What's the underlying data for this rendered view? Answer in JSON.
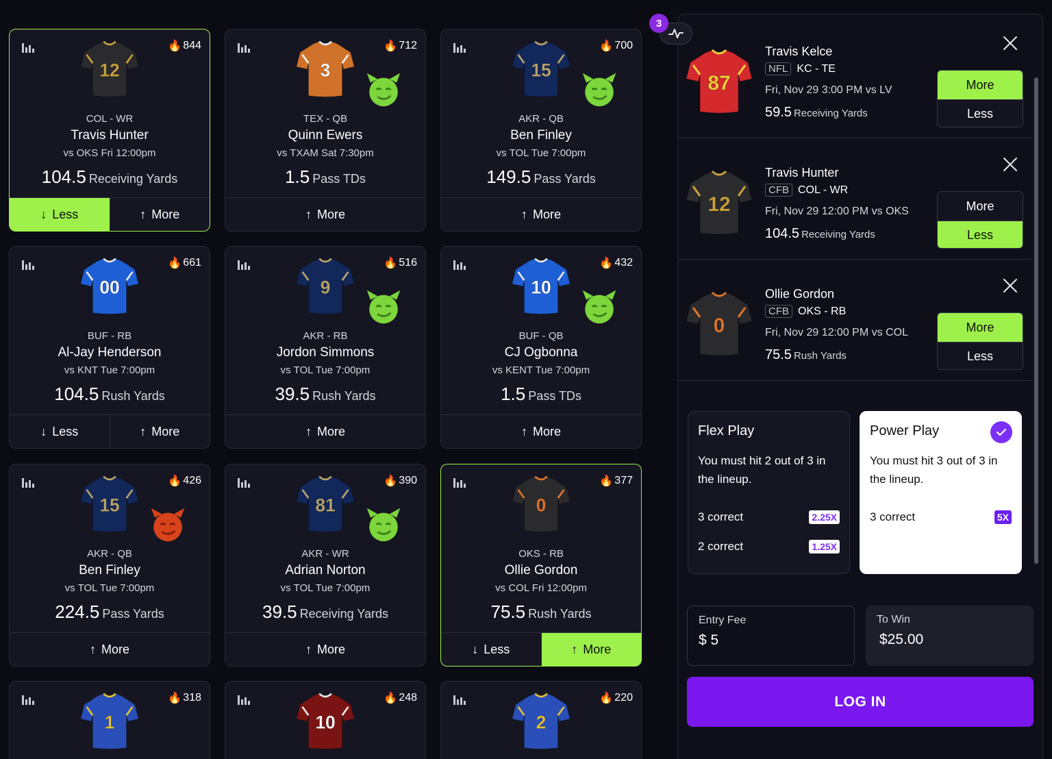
{
  "cards": [
    {
      "pos": "COL - WR",
      "name": "Travis Hunter",
      "game": "vs OKS Fri 12:00pm",
      "line": "104.5",
      "stat": "Receiving Yards",
      "heat": "844",
      "jersey": {
        "color": "#2b2b2e",
        "trim": "#c9a13f",
        "number": "12"
      },
      "emoji": "none",
      "actions": [
        {
          "label": "Less",
          "dir": "down",
          "on": true
        },
        {
          "label": "More",
          "dir": "up",
          "on": false
        }
      ],
      "selected": true
    },
    {
      "pos": "TEX - QB",
      "name": "Quinn Ewers",
      "game": "vs TXAM Sat 7:30pm",
      "line": "1.5",
      "stat": "Pass TDs",
      "heat": "712",
      "jersey": {
        "color": "#d0722a",
        "trim": "#f2f2f2",
        "number": "3"
      },
      "emoji": "goblin",
      "actions": [
        {
          "label": "More",
          "dir": "up",
          "on": false
        }
      ],
      "selected": false
    },
    {
      "pos": "AKR - QB",
      "name": "Ben Finley",
      "game": "vs TOL Tue 7:00pm",
      "line": "149.5",
      "stat": "Pass Yards",
      "heat": "700",
      "jersey": {
        "color": "#12275a",
        "trim": "#b8a46a",
        "number": "15"
      },
      "emoji": "goblin",
      "actions": [
        {
          "label": "More",
          "dir": "up",
          "on": false
        }
      ],
      "selected": false
    },
    {
      "pos": "BUF - RB",
      "name": "Al-Jay Henderson",
      "game": "vs KNT Tue 7:00pm",
      "line": "104.5",
      "stat": "Rush Yards",
      "heat": "661",
      "jersey": {
        "color": "#1f5fd6",
        "trim": "#e8e8e8",
        "number": "00"
      },
      "emoji": "none",
      "actions": [
        {
          "label": "Less",
          "dir": "down",
          "on": false
        },
        {
          "label": "More",
          "dir": "up",
          "on": false
        }
      ],
      "selected": false
    },
    {
      "pos": "AKR - RB",
      "name": "Jordon Simmons",
      "game": "vs TOL Tue 7:00pm",
      "line": "39.5",
      "stat": "Rush Yards",
      "heat": "516",
      "jersey": {
        "color": "#12275a",
        "trim": "#b8a46a",
        "number": "9"
      },
      "emoji": "goblin",
      "actions": [
        {
          "label": "More",
          "dir": "up",
          "on": false
        }
      ],
      "selected": false
    },
    {
      "pos": "BUF - QB",
      "name": "CJ Ogbonna",
      "game": "vs KENT Tue 7:00pm",
      "line": "1.5",
      "stat": "Pass TDs",
      "heat": "432",
      "jersey": {
        "color": "#1f5fd6",
        "trim": "#e8e8e8",
        "number": "10"
      },
      "emoji": "goblin",
      "actions": [
        {
          "label": "More",
          "dir": "up",
          "on": false
        }
      ],
      "selected": false
    },
    {
      "pos": "AKR - QB",
      "name": "Ben Finley",
      "game": "vs TOL Tue 7:00pm",
      "line": "224.5",
      "stat": "Pass Yards",
      "heat": "426",
      "jersey": {
        "color": "#12275a",
        "trim": "#b8a46a",
        "number": "15"
      },
      "emoji": "demon",
      "actions": [
        {
          "label": "More",
          "dir": "up",
          "on": false
        }
      ],
      "selected": false
    },
    {
      "pos": "AKR - WR",
      "name": "Adrian Norton",
      "game": "vs TOL Tue 7:00pm",
      "line": "39.5",
      "stat": "Receiving Yards",
      "heat": "390",
      "jersey": {
        "color": "#12275a",
        "trim": "#b8a46a",
        "number": "81"
      },
      "emoji": "goblin",
      "actions": [
        {
          "label": "More",
          "dir": "up",
          "on": false
        }
      ],
      "selected": false
    },
    {
      "pos": "OKS - RB",
      "name": "Ollie Gordon",
      "game": "vs COL Fri 12:00pm",
      "line": "75.5",
      "stat": "Rush Yards",
      "heat": "377",
      "jersey": {
        "color": "#2b2b2e",
        "trim": "#e0752a",
        "number": "0"
      },
      "emoji": "none",
      "actions": [
        {
          "label": "Less",
          "dir": "down",
          "on": false
        },
        {
          "label": "More",
          "dir": "up",
          "on": true
        }
      ],
      "selected": true
    },
    {
      "pos": "",
      "name": "",
      "game": "",
      "line": "",
      "stat": "",
      "heat": "318",
      "jersey": {
        "color": "#2a4fb8",
        "trim": "#e2c23a",
        "number": "1"
      },
      "emoji": "none",
      "actions": [],
      "selected": false
    },
    {
      "pos": "",
      "name": "",
      "game": "",
      "line": "",
      "stat": "",
      "heat": "248",
      "jersey": {
        "color": "#7a1414",
        "trim": "#e8e8e8",
        "number": "10"
      },
      "emoji": "none",
      "actions": [],
      "selected": false
    },
    {
      "pos": "",
      "name": "",
      "game": "",
      "line": "",
      "stat": "",
      "heat": "220",
      "jersey": {
        "color": "#2a4fb8",
        "trim": "#e2c23a",
        "number": "2"
      },
      "emoji": "none",
      "actions": [],
      "selected": false
    }
  ],
  "panel": {
    "count": "3",
    "picks": [
      {
        "name": "Travis Kelce",
        "league": "NFL",
        "team": "KC - TE",
        "game": "Fri, Nov 29 3:00 PM vs LV",
        "line": "59.5",
        "stat": "Receiving Yards",
        "more": "More",
        "less": "Less",
        "choice": "more",
        "jersey": {
          "color": "#d42a2e",
          "trim": "#f4d23a",
          "number": "87"
        }
      },
      {
        "name": "Travis Hunter",
        "league": "CFB",
        "team": "COL - WR",
        "game": "Fri, Nov 29 12:00 PM vs OKS",
        "line": "104.5",
        "stat": "Receiving Yards",
        "more": "More",
        "less": "Less",
        "choice": "less",
        "jersey": {
          "color": "#2b2b2e",
          "trim": "#c9a13f",
          "number": "12"
        }
      },
      {
        "name": "Ollie Gordon",
        "league": "CFB",
        "team": "OKS - RB",
        "game": "Fri, Nov 29 12:00 PM vs COL",
        "line": "75.5",
        "stat": "Rush Yards",
        "more": "More",
        "less": "Less",
        "choice": "more",
        "jersey": {
          "color": "#2b2b2e",
          "trim": "#e0752a",
          "number": "0"
        }
      }
    ],
    "flex": {
      "title": "Flex Play",
      "desc": "You must hit 2 out of 3 in the lineup.",
      "rows": [
        {
          "label": "3 correct",
          "mult": "2.25X"
        },
        {
          "label": "2 correct",
          "mult": "1.25X"
        }
      ]
    },
    "power": {
      "title": "Power Play",
      "desc": "You must hit 3 out of 3 in the lineup.",
      "rows": [
        {
          "label": "3 correct",
          "mult": "5X"
        }
      ],
      "selected": true
    },
    "entry_fee": {
      "label": "Entry Fee",
      "value": "$ 5"
    },
    "to_win": {
      "label": "To Win",
      "value": "$25.00"
    },
    "login": "LOG IN"
  }
}
